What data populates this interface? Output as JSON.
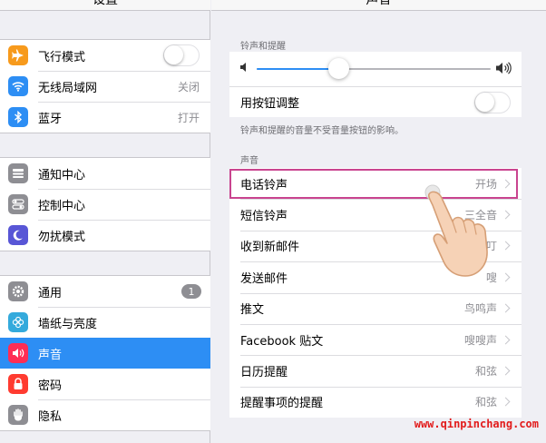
{
  "left": {
    "header": "设置",
    "group1": [
      {
        "name": "airplane",
        "icon": "airplane-icon",
        "color": "#f79a1c",
        "label": "飞行模式",
        "value": "",
        "toggle": "off"
      },
      {
        "name": "wifi",
        "icon": "wifi-icon",
        "color": "#2d8ef4",
        "label": "无线局域网",
        "value": "关闭"
      },
      {
        "name": "bluetooth",
        "icon": "bluetooth-icon",
        "color": "#2d8ef4",
        "label": "蓝牙",
        "value": "打开"
      }
    ],
    "group2": [
      {
        "name": "notification-center",
        "icon": "notification-icon",
        "color": "#8e8e93",
        "label": "通知中心"
      },
      {
        "name": "control-center",
        "icon": "control-center-icon",
        "color": "#8e8e93",
        "label": "控制中心"
      },
      {
        "name": "do-not-disturb",
        "icon": "moon-icon",
        "color": "#5856d6",
        "label": "勿扰模式"
      }
    ],
    "group3": [
      {
        "name": "general",
        "icon": "gear-icon",
        "color": "#8e8e93",
        "label": "通用",
        "badge": "1"
      },
      {
        "name": "wallpaper",
        "icon": "flower-icon",
        "color": "#34aadc",
        "label": "墙纸与亮度"
      },
      {
        "name": "sounds",
        "icon": "speaker-icon",
        "color": "#ff2d55",
        "label": "声音",
        "selected": true
      },
      {
        "name": "passcode",
        "icon": "lock-icon",
        "color": "#ff3b30",
        "label": "密码"
      },
      {
        "name": "privacy",
        "icon": "hand-icon",
        "color": "#8e8e93",
        "label": "隐私"
      }
    ]
  },
  "right": {
    "header": "声音",
    "ringer_section_title": "铃声和提醒",
    "volume_level": 0.35,
    "change_with_buttons_label": "用按钮调整",
    "change_with_buttons_toggle": "off",
    "note": "铃声和提醒的音量不受音量按钮的影响。",
    "sounds_section_title": "声音",
    "sounds": [
      {
        "name": "ringtone",
        "label": "电话铃声",
        "value": "开场"
      },
      {
        "name": "text-tone",
        "label": "短信铃声",
        "value": "三全音"
      },
      {
        "name": "new-mail",
        "label": "收到新邮件",
        "value": "叮"
      },
      {
        "name": "sent-mail",
        "label": "发送邮件",
        "value": "嗖"
      },
      {
        "name": "tweet",
        "label": "推文",
        "value": "鸟鸣声"
      },
      {
        "name": "facebook-post",
        "label": "Facebook 贴文",
        "value": "嗖嗖声"
      },
      {
        "name": "calendar-alerts",
        "label": "日历提醒",
        "value": "和弦"
      },
      {
        "name": "reminder-alerts",
        "label": "提醒事项的提醒",
        "value": "和弦"
      }
    ],
    "highlight_color": "#c9448f"
  },
  "watermark": "www.qinpinchang.com",
  "colors": {
    "accent": "#2d8ef4",
    "watermark": "#e21b1b"
  }
}
